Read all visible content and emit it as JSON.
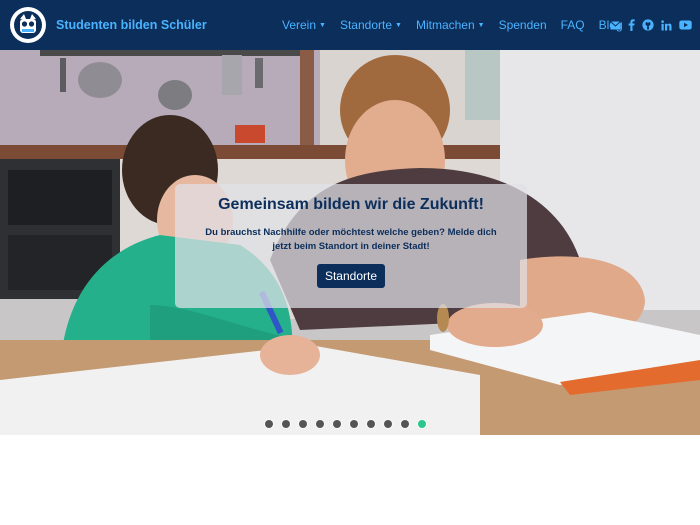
{
  "header": {
    "brand": "Studenten bilden Schüler",
    "nav": [
      {
        "label": "Verein",
        "dropdown": true
      },
      {
        "label": "Standorte",
        "dropdown": true
      },
      {
        "label": "Mitmachen",
        "dropdown": true
      },
      {
        "label": "Spenden",
        "dropdown": false
      },
      {
        "label": "FAQ",
        "dropdown": false
      },
      {
        "label": "Blog",
        "dropdown": false
      }
    ],
    "social_icons": [
      "mail-icon",
      "facebook-icon",
      "github-icon",
      "linkedin-icon",
      "youtube-icon"
    ]
  },
  "hero": {
    "title": "Gemeinsam bilden wir die Zukunft!",
    "text": "Du brauchst Nachhilfe oder möchtest welche geben? Melde dich jetzt beim Standort in deiner Stadt!",
    "button": "Standorte",
    "slides_count": 10,
    "active_slide": 10
  },
  "colors": {
    "header_bg": "#0b2e5b",
    "link": "#4ab3ff",
    "active_dot": "#27c78d"
  }
}
